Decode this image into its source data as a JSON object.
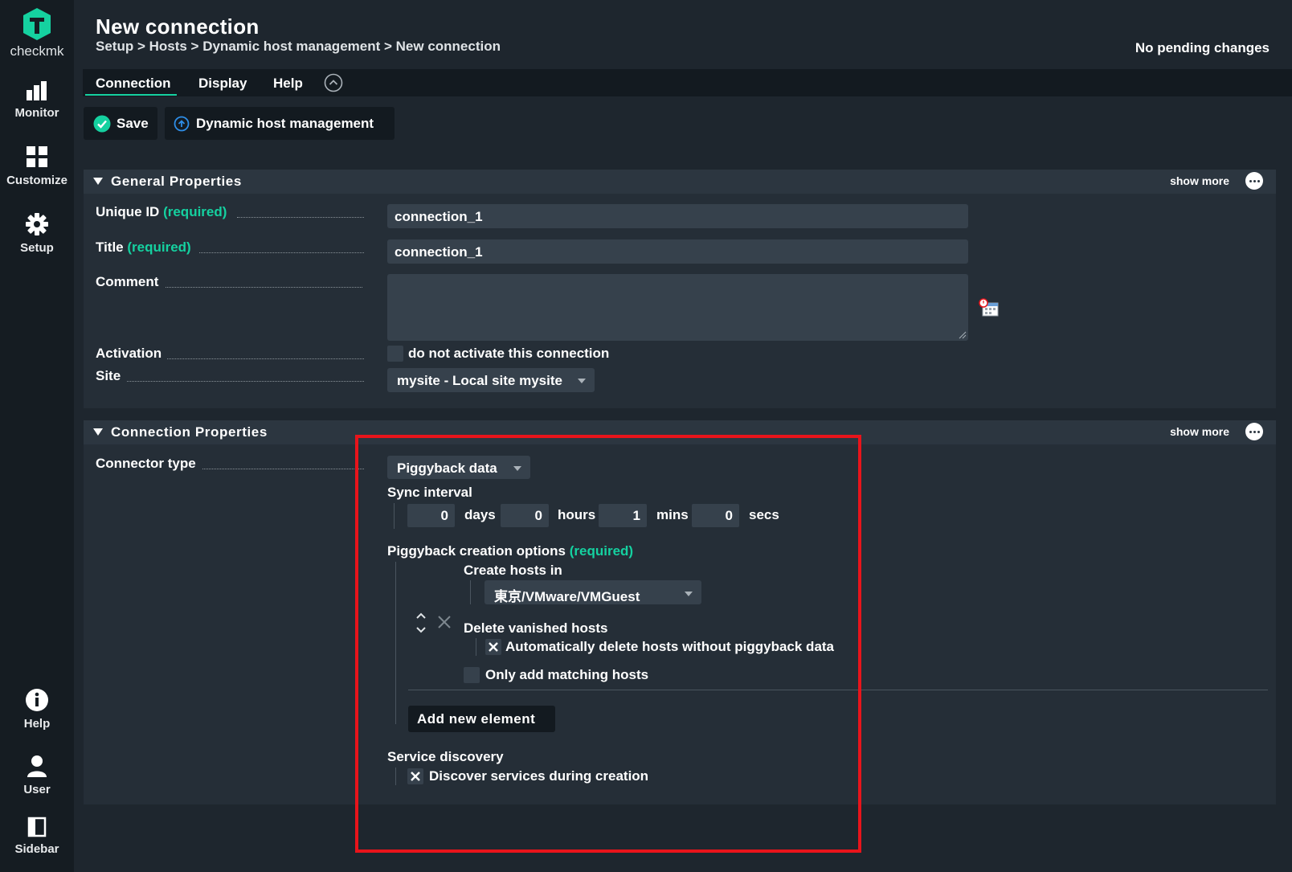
{
  "app": {
    "logo_text": "checkmk"
  },
  "nav": [
    {
      "label": "Monitor",
      "icon": "monitor-icon"
    },
    {
      "label": "Customize",
      "icon": "customize-icon"
    },
    {
      "label": "Setup",
      "icon": "gear-icon"
    },
    {
      "label": "Help",
      "icon": "info-icon"
    },
    {
      "label": "User",
      "icon": "user-icon"
    },
    {
      "label": "Sidebar",
      "icon": "sidebar-icon"
    }
  ],
  "header": {
    "title": "New connection",
    "breadcrumb": "Setup > Hosts > Dynamic host management > New connection",
    "pending": "No pending changes"
  },
  "tabs": [
    {
      "label": "Connection",
      "active": true
    },
    {
      "label": "Display"
    },
    {
      "label": "Help"
    }
  ],
  "toolbar": {
    "save_label": "Save",
    "dhm_label": "Dynamic host management"
  },
  "general": {
    "title": "General Properties",
    "show_more": "show more",
    "unique_id_label": "Unique ID",
    "title_label": "Title",
    "required": "(required)",
    "comment_label": "Comment",
    "activation_label": "Activation",
    "site_label": "Site",
    "unique_id_value": "connection_1",
    "title_value": "connection_1",
    "activation_checkbox": "do not activate this connection",
    "site_value": "mysite - Local site mysite"
  },
  "connection": {
    "title": "Connection Properties",
    "show_more": "show more",
    "connector_type_label": "Connector type",
    "connector_type_value": "Piggyback data",
    "sync_interval_label": "Sync interval",
    "sync": [
      {
        "value": "0",
        "unit": "days"
      },
      {
        "value": "0",
        "unit": "hours"
      },
      {
        "value": "1",
        "unit": "mins"
      },
      {
        "value": "0",
        "unit": "secs"
      }
    ],
    "piggyback_label": "Piggyback creation options",
    "required": "(required)",
    "create_hosts_label": "Create hosts in",
    "create_hosts_value": "東京/VMware/VMGuest",
    "delete_vanished_label": "Delete vanished hosts",
    "auto_delete_label": "Automatically delete hosts without piggyback data",
    "only_matching_label": "Only add matching hosts",
    "add_element_label": "Add new element",
    "service_discovery_label": "Service discovery",
    "discover_label": "Discover services during creation"
  },
  "colors": {
    "accent": "#15d1a0",
    "highlight": "#e8141b",
    "background": "#1e262e"
  }
}
